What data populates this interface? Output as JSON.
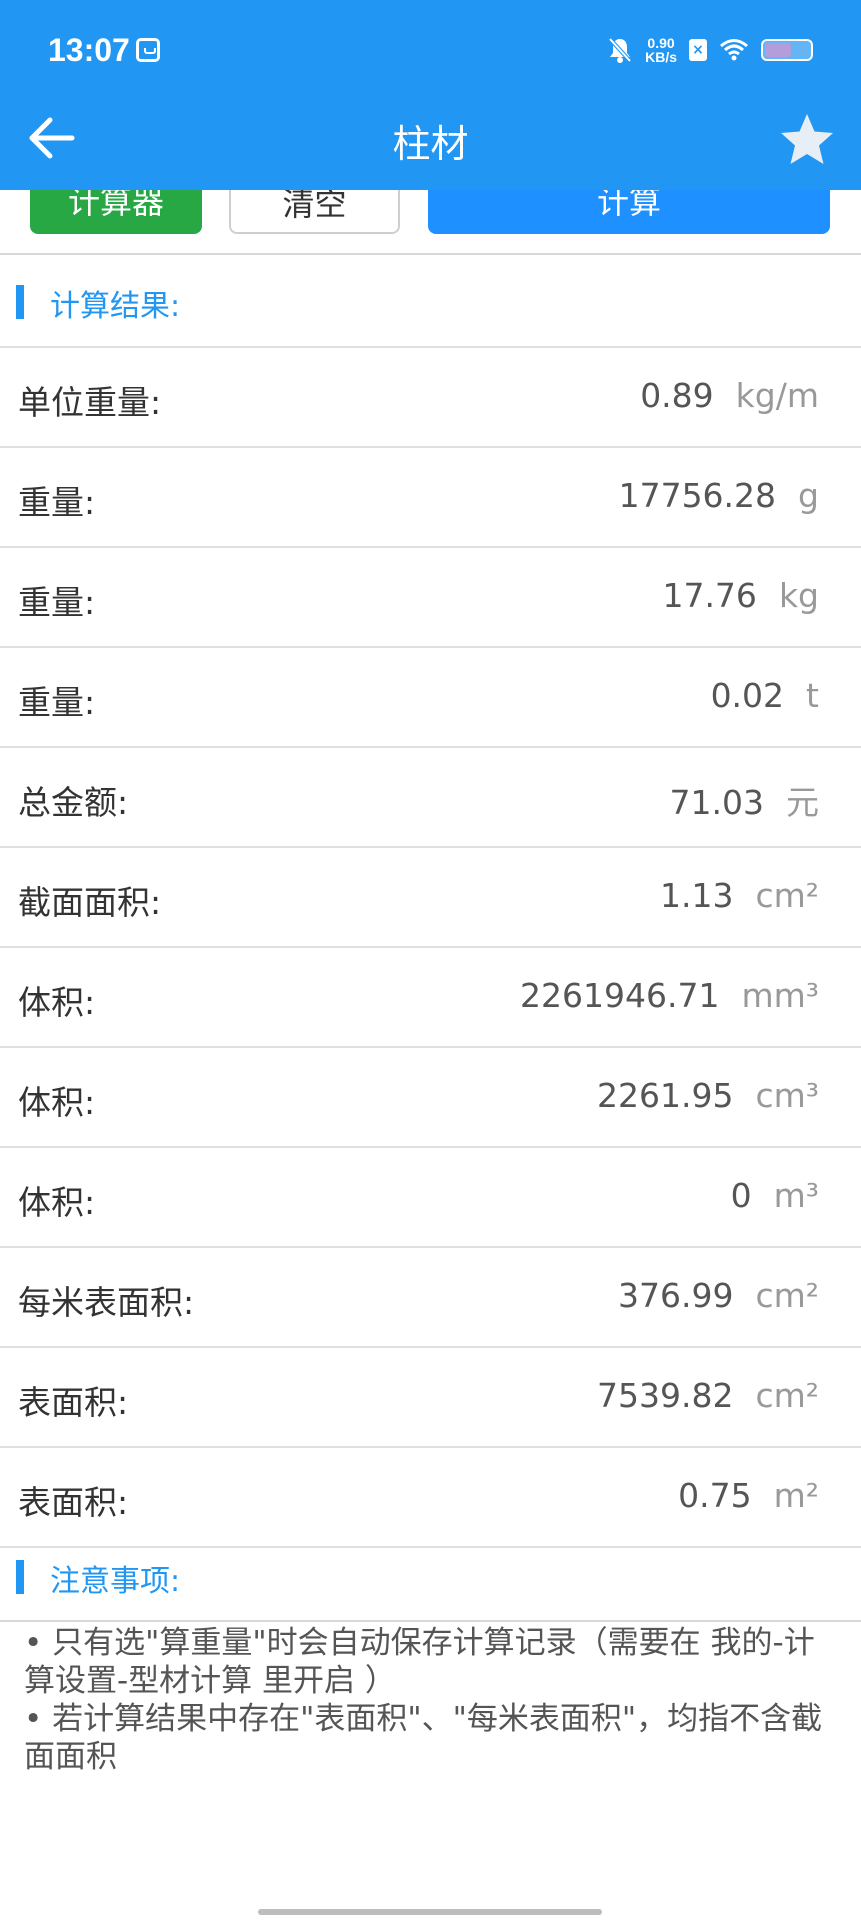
{
  "status_bar": {
    "time": "13:07",
    "net_speed_value": "0.90",
    "net_speed_unit": "KB/s",
    "battery_level": 0.6
  },
  "header": {
    "title": "柱材"
  },
  "actions": {
    "calculator_label": "计算器",
    "clear_label": "清空",
    "calculate_label": "计算"
  },
  "results": {
    "title": "计算结果:",
    "rows": [
      {
        "label": "单位重量:",
        "value": "0.89",
        "unit": "kg/m"
      },
      {
        "label": "重量:",
        "value": "17756.28",
        "unit": "g"
      },
      {
        "label": "重量:",
        "value": "17.76",
        "unit": "kg"
      },
      {
        "label": "重量:",
        "value": "0.02",
        "unit": "t"
      },
      {
        "label": "总金额:",
        "value": "71.03",
        "unit": "元"
      },
      {
        "label": "截面面积:",
        "value": "1.13",
        "unit": "cm²"
      },
      {
        "label": "体积:",
        "value": "2261946.71",
        "unit": "mm³"
      },
      {
        "label": "体积:",
        "value": "2261.95",
        "unit": "cm³"
      },
      {
        "label": "体积:",
        "value": "0",
        "unit": "m³"
      },
      {
        "label": "每米表面积:",
        "value": "376.99",
        "unit": "cm²"
      },
      {
        "label": "表面积:",
        "value": "7539.82",
        "unit": "cm²"
      },
      {
        "label": "表面积:",
        "value": "0.75",
        "unit": "m²"
      }
    ]
  },
  "notes": {
    "title": "注意事项:",
    "items": [
      "• 只有选\"算重量\"时会自动保存计算记录（需要在 我的-计算设置-型材计算 里开启 ）",
      "• 若计算结果中存在\"表面积\"、\"每米表面积\"，均指不含截面面积"
    ]
  },
  "colors": {
    "primary": "#2196F3",
    "calculator_green": "#28A745",
    "calculate_blue": "#1E90FF"
  },
  "icons": {
    "back": "arrow-left-icon",
    "favorite": "star-icon",
    "notification": "bell-off-icon",
    "wifi": "wifi-icon"
  }
}
